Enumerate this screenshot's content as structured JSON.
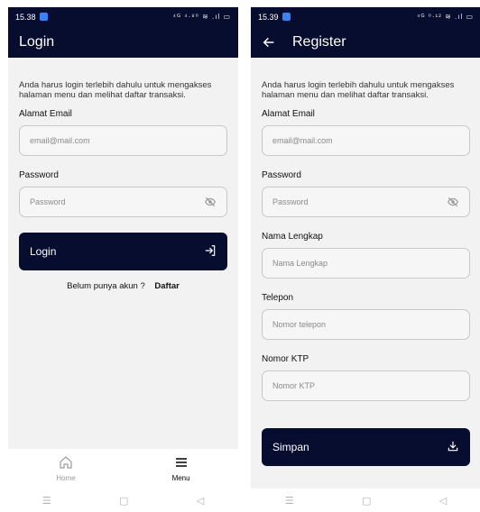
{
  "login": {
    "status": {
      "time": "15.38",
      "icons": "⁴ᴳ ⁴·⁸⁰ ≋ .ıl ▭"
    },
    "title": "Login",
    "info": "Anda harus login terlebih dahulu untuk mengakses halaman menu dan melihat daftar transaksi.",
    "email": {
      "label": "Alamat Email",
      "placeholder": "email@mail.com"
    },
    "password": {
      "label": "Password",
      "placeholder": "Password"
    },
    "button": "Login",
    "register_prompt": "Belum punya akun ?",
    "register_link": "Daftar",
    "nav": [
      {
        "label": "Home",
        "icon": "home-icon",
        "active": false
      },
      {
        "label": "Menu",
        "icon": "menu-icon",
        "active": true
      }
    ]
  },
  "register": {
    "status": {
      "time": "15.39",
      "icons": "⁴ᴳ ⁰·¹² ≋ .ıl ▭"
    },
    "title": "Register",
    "info": "Anda harus login terlebih dahulu untuk mengakses halaman menu dan melihat daftar transaksi.",
    "email": {
      "label": "Alamat Email",
      "placeholder": "email@mail.com"
    },
    "password": {
      "label": "Password",
      "placeholder": "Password"
    },
    "name": {
      "label": "Nama Lengkap",
      "placeholder": "Nama Lengkap"
    },
    "phone": {
      "label": "Telepon",
      "placeholder": "Nomor telepon"
    },
    "ktp": {
      "label": "Nomor KTP",
      "placeholder": "Nomor KTP"
    },
    "button": "Simpan"
  },
  "colors": {
    "primary": "#070d2e",
    "background": "#f2f2f2",
    "field_border": "#c8c8c8"
  }
}
